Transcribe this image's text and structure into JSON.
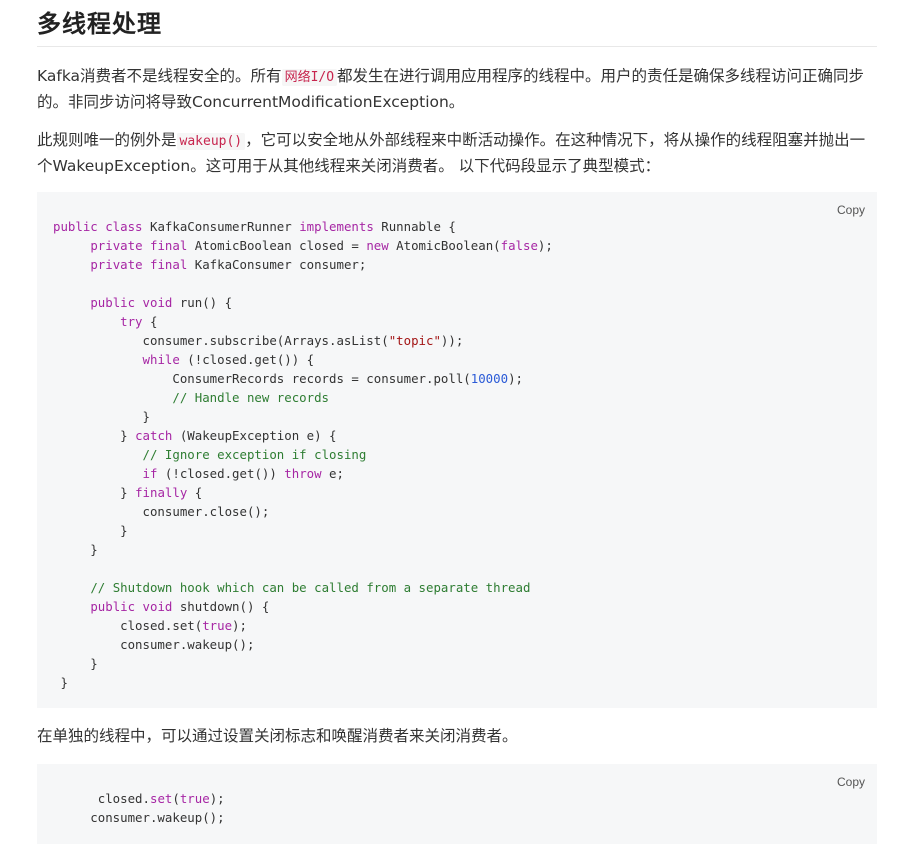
{
  "heading": "多线程处理",
  "para1": {
    "before": "Kafka消费者不是线程安全的。所有",
    "code": "网络I/O",
    "after": "都发生在进行调用应用程序的线程中。用户的责任是确保多线程访问正确同步的。非同步访问将导致ConcurrentModificationException。"
  },
  "para2": {
    "before": "此规则唯一的例外是",
    "code": "wakeup()",
    "after": "，它可以安全地从外部线程来中断活动操作。在这种情况下，将从操作的线程阻塞并抛出一个WakeupException。这可用于从其他线程来关闭消费者。 以下代码段显示了典型模式："
  },
  "para3": "在单独的线程中，可以通过设置关闭标志和唤醒消费者来关闭消费者。",
  "copy_label": "Copy",
  "code1": [
    [
      [
        "k",
        "public class "
      ],
      [
        "t",
        "KafkaConsumerRunner "
      ],
      [
        "k",
        "implements "
      ],
      [
        "t",
        "Runnable {"
      ]
    ],
    [
      [
        "t",
        "     "
      ],
      [
        "k",
        "private final "
      ],
      [
        "t",
        "AtomicBoolean closed = "
      ],
      [
        "k",
        "new "
      ],
      [
        "t",
        "AtomicBoolean("
      ],
      [
        "k",
        "false"
      ],
      [
        "t",
        ");"
      ]
    ],
    [
      [
        "t",
        "     "
      ],
      [
        "k",
        "private final "
      ],
      [
        "t",
        "KafkaConsumer consumer;"
      ]
    ],
    [
      [
        "t",
        ""
      ]
    ],
    [
      [
        "t",
        "     "
      ],
      [
        "k",
        "public void "
      ],
      [
        "t",
        "run() {"
      ]
    ],
    [
      [
        "t",
        "         "
      ],
      [
        "k",
        "try "
      ],
      [
        "t",
        "{"
      ]
    ],
    [
      [
        "t",
        "            consumer.subscribe(Arrays.asList("
      ],
      [
        "s",
        "\"topic\""
      ],
      [
        "t",
        "));"
      ]
    ],
    [
      [
        "t",
        "            "
      ],
      [
        "k",
        "while "
      ],
      [
        "t",
        "(!closed.get()) {"
      ]
    ],
    [
      [
        "t",
        "                ConsumerRecords records = consumer.poll("
      ],
      [
        "n",
        "10000"
      ],
      [
        "t",
        ");"
      ]
    ],
    [
      [
        "t",
        "                "
      ],
      [
        "c",
        "// Handle new records"
      ]
    ],
    [
      [
        "t",
        "            }"
      ]
    ],
    [
      [
        "t",
        "         } "
      ],
      [
        "k",
        "catch "
      ],
      [
        "t",
        "(WakeupException e) {"
      ]
    ],
    [
      [
        "t",
        "            "
      ],
      [
        "c",
        "// Ignore exception if closing"
      ]
    ],
    [
      [
        "t",
        "            "
      ],
      [
        "k",
        "if "
      ],
      [
        "t",
        "(!closed.get()) "
      ],
      [
        "k",
        "throw "
      ],
      [
        "t",
        "e;"
      ]
    ],
    [
      [
        "t",
        "         } "
      ],
      [
        "k",
        "finally "
      ],
      [
        "t",
        "{"
      ]
    ],
    [
      [
        "t",
        "            consumer.close();"
      ]
    ],
    [
      [
        "t",
        "         }"
      ]
    ],
    [
      [
        "t",
        "     }"
      ]
    ],
    [
      [
        "t",
        ""
      ]
    ],
    [
      [
        "t",
        "     "
      ],
      [
        "c",
        "// Shutdown hook which can be called from a separate thread"
      ]
    ],
    [
      [
        "t",
        "     "
      ],
      [
        "k",
        "public void "
      ],
      [
        "t",
        "shutdown() {"
      ]
    ],
    [
      [
        "t",
        "         closed.set("
      ],
      [
        "k",
        "true"
      ],
      [
        "t",
        ");"
      ]
    ],
    [
      [
        "t",
        "         consumer.wakeup();"
      ]
    ],
    [
      [
        "t",
        "     }"
      ]
    ],
    [
      [
        "t",
        " }"
      ]
    ]
  ],
  "code2": [
    [
      [
        "t",
        "      closed."
      ],
      [
        "k",
        "set"
      ],
      [
        "t",
        "("
      ],
      [
        "k",
        "true"
      ],
      [
        "t",
        ");"
      ]
    ],
    [
      [
        "t",
        "     consumer.wakeup();"
      ]
    ]
  ]
}
